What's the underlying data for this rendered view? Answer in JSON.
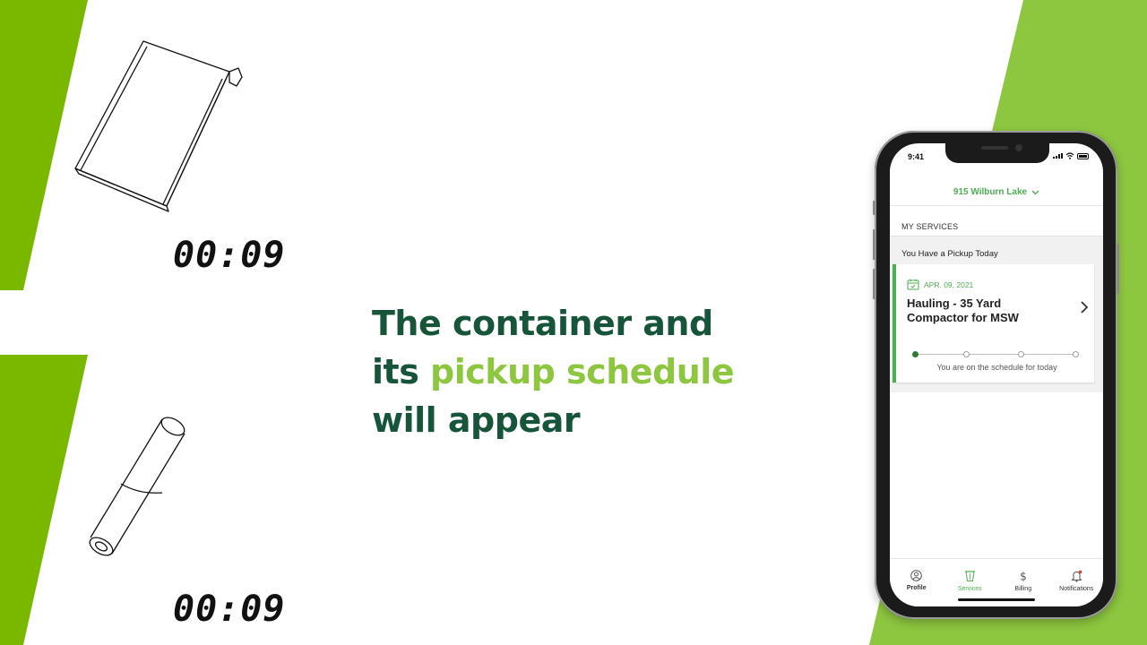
{
  "colors": {
    "brand_green_light": "#7ab800",
    "brand_green_lime": "#8dc63f",
    "headline_dark_green": "#17553b",
    "app_green": "#4caf50"
  },
  "timers": {
    "top": "00:09",
    "bottom": "00:09"
  },
  "headline": {
    "line1": "The container and",
    "line2_prefix": "its ",
    "line2_highlight": "pickup schedule",
    "line3": "will appear"
  },
  "phone": {
    "status_time": "9:41",
    "address": "915 Wilburn Lake",
    "section_title": "MY SERVICES",
    "pickup_notice": "You Have a Pickup Today",
    "card": {
      "date": "APR. 09, 2021",
      "title": "Hauling - 35 Yard Compactor for MSW",
      "status": "You are on the schedule for today",
      "progress_steps": 4,
      "active_step": 1
    },
    "tabs": [
      {
        "label": "Profile",
        "icon": "profile-icon"
      },
      {
        "label": "Services",
        "icon": "services-icon"
      },
      {
        "label": "Billing",
        "icon": "dollar-icon"
      },
      {
        "label": "Notifications",
        "icon": "bell-icon"
      }
    ]
  }
}
